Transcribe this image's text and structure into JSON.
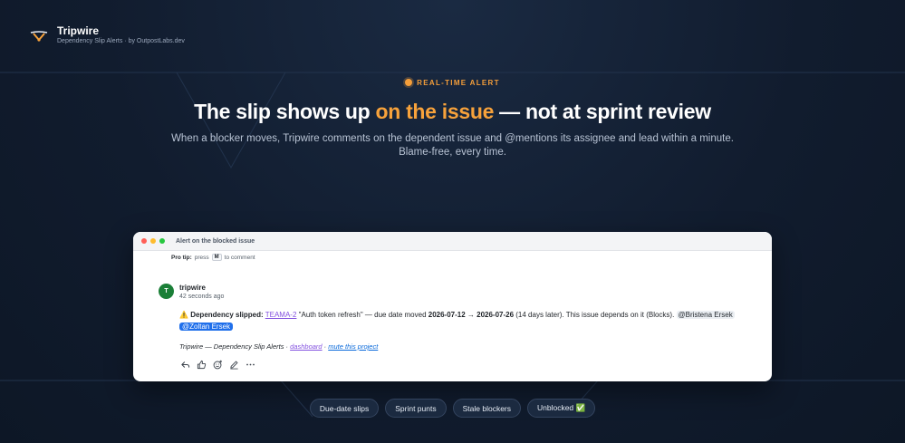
{
  "brand": {
    "name": "Tripwire",
    "subtitle": "Dependency Slip Alerts · by OutpostLabs.dev",
    "logo_icon": "tripwire-logo-icon"
  },
  "hero": {
    "eyebrow": "REAL-TIME ALERT",
    "headline_before": "The slip shows up ",
    "headline_accent": "on the issue",
    "headline_after": " — not at sprint review",
    "subline_1": "When a blocker moves, Tripwire comments on the dependent issue and @mentions its assignee and lead within a minute.",
    "subline_2": "Blame-free, every time."
  },
  "colors": {
    "accent": "#f7a23b",
    "background": "#111c2e",
    "avatar": "#1a7f37",
    "mention_highlight": "#1f6feb",
    "link": "#8250df"
  },
  "card": {
    "window_title": "Alert on the blocked issue",
    "protip_label": "Pro tip:",
    "protip_pre": "press",
    "protip_key": "M",
    "protip_post": "to comment",
    "comment": {
      "avatar_letter": "T",
      "author": "tripwire",
      "time": "42 seconds ago",
      "warning_icon": "⚠️",
      "lead": "Dependency slipped:",
      "issue_link": "TEAMA-2",
      "issue_title": " \"Auth token refresh\" — due date moved ",
      "date_from": "2026-07-12",
      "arrow": " → ",
      "date_to": "2026-07-26",
      "after_dates": " (14 days later). This issue depends on it (Blocks).",
      "mention_1": "@Bristena Ersek",
      "mention_2": "@Zoltan Ersek",
      "signature": "Tripwire — Dependency Slip Alerts ·",
      "dashboard_link": "dashboard",
      "sep": " · ",
      "mute_link": "mute this project"
    },
    "actions": [
      {
        "name": "reply-icon"
      },
      {
        "name": "thumbs-up-icon"
      },
      {
        "name": "add-reaction-icon"
      },
      {
        "name": "edit-icon"
      },
      {
        "name": "more-icon"
      }
    ]
  },
  "pills": [
    {
      "label": "Due-date slips"
    },
    {
      "label": "Sprint punts"
    },
    {
      "label": "Stale blockers"
    },
    {
      "label": "Unblocked ✅"
    }
  ]
}
